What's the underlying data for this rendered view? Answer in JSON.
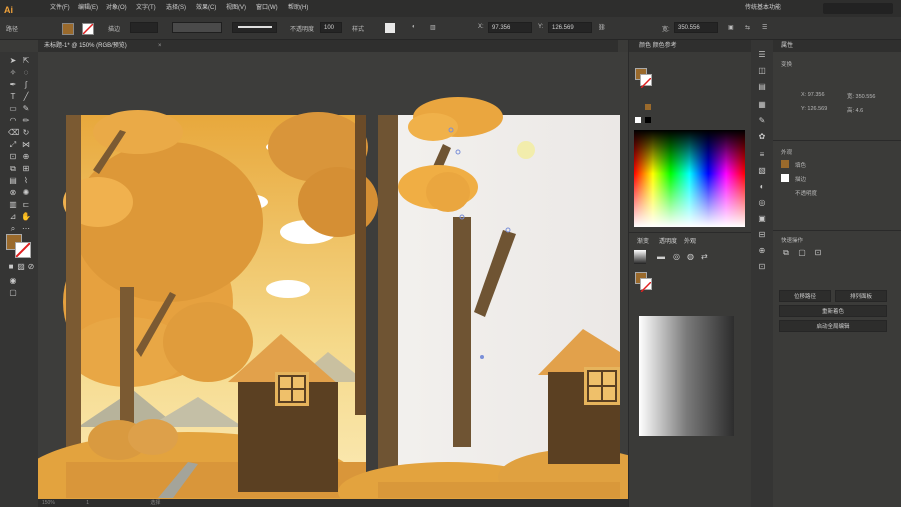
{
  "app": {
    "logo": "Ai"
  },
  "menu": {
    "items": [
      "文件(F)",
      "编辑(E)",
      "对象(O)",
      "文字(T)",
      "选择(S)",
      "效果(C)",
      "视图(V)",
      "窗口(W)",
      "帮助(H)"
    ],
    "workspace": "传统基本功能"
  },
  "control": {
    "left_label": "路径",
    "stroke_label": "描边",
    "stroke_value": "",
    "profile": "",
    "opacity_label": "不透明度",
    "opacity_value": "100",
    "style_label": "样式",
    "x_label": "X:",
    "x_value": "97.356",
    "y_label": "Y:",
    "y_value": "126.569",
    "w_label": "宽:",
    "w_value": "350.556",
    "fill_color": "#9a6a2c"
  },
  "document": {
    "tab_label": "未标题-1* @ 150% (RGB/预览)",
    "close": "×"
  },
  "status": {
    "zoom": "150%",
    "page": "1",
    "mode": "选择"
  },
  "color_panel": {
    "title": "颜色  颜色参考",
    "tab1": "渐变",
    "tab2": "透明度",
    "tab3": "外观"
  },
  "properties": {
    "title": "属性",
    "section1": "变换",
    "x": "X: 97.356",
    "y": "Y: 126.569",
    "w": "宽: 350.556",
    "h": "高: 4.6",
    "section2": "外观",
    "fill_label": "填色",
    "stroke_label": "描边",
    "opacity_label": "不透明度",
    "section3": "快速操作",
    "btn1": "位移路径",
    "btn2": "排列面板",
    "btn3": "重新着色",
    "btn4": "启动全局编辑"
  },
  "colors": {
    "accent": "#f0a23a",
    "golden": "#e6a13f",
    "brown": "#5b4022",
    "sky": "#f0d58a"
  }
}
